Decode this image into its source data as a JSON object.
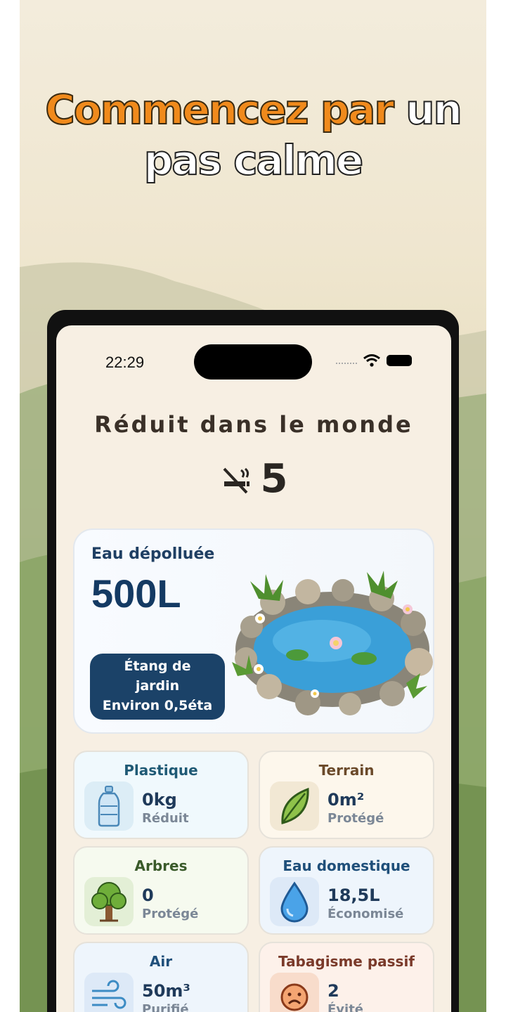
{
  "headline": {
    "highlight": "Commencez par",
    "plain_1": " un",
    "plain_2": "pas calme"
  },
  "status": {
    "time": "22:29"
  },
  "screen": {
    "title": "Réduit dans le monde",
    "count": "5",
    "count_icon": "no-smoking-icon"
  },
  "water_card": {
    "label": "Eau dépolluée",
    "value": "500L",
    "pill_line1": "Étang de",
    "pill_line2": "jardin",
    "pill_line3": "Environ 0,5éta",
    "image": "garden-pond-illustration"
  },
  "stats": [
    {
      "title": "Plastique",
      "value": "0kg",
      "sub": "Réduit",
      "icon": "water-bottle-icon",
      "title_color": "#1f5a75",
      "bg": "#f0f9fd",
      "icon_bg": "#dcedf6"
    },
    {
      "title": "Terrain",
      "value": "0m²",
      "sub": "Protégé",
      "icon": "leaf-icon",
      "title_color": "#6b4a2a",
      "bg": "#fdf7ec",
      "icon_bg": "#f2e8d4"
    },
    {
      "title": "Arbres",
      "value": "0",
      "sub": "Protégé",
      "icon": "tree-icon",
      "title_color": "#3a5a2a",
      "bg": "#f6faef",
      "icon_bg": "#e3efd6"
    },
    {
      "title": "Eau domestique",
      "value": "18,5L",
      "sub": "Économisé",
      "icon": "water-drop-icon",
      "title_color": "#1f4f7a",
      "bg": "#eef5fc",
      "icon_bg": "#dde9f7"
    },
    {
      "title": "Air",
      "value": "50m³",
      "sub": "Purifié",
      "icon": "wind-icon",
      "title_color": "#1f4f7a",
      "bg": "#eef5fc",
      "icon_bg": "#dde9f7"
    },
    {
      "title": "Tabagisme passif",
      "value": "2",
      "sub": "Évité",
      "icon": "sad-face-icon",
      "title_color": "#7a3a2a",
      "bg": "#fdf1ea",
      "icon_bg": "#f8dccb"
    }
  ]
}
